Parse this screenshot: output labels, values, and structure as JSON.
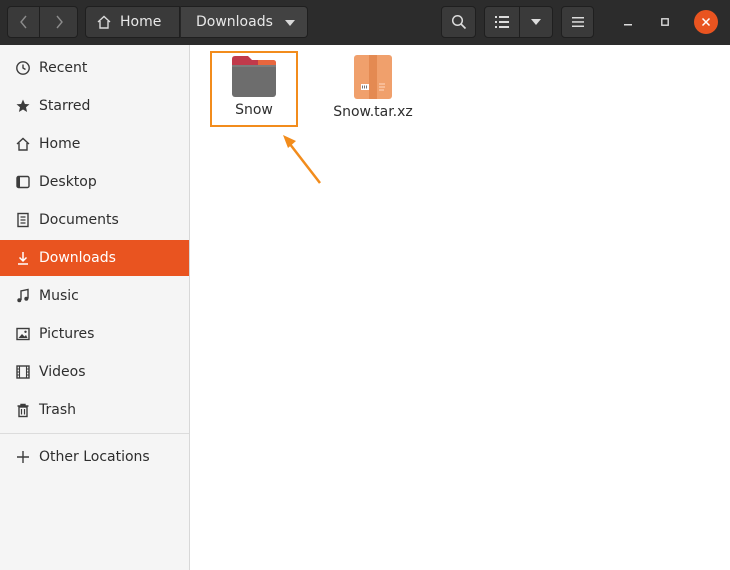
{
  "header": {
    "breadcrumb": {
      "home_label": "Home",
      "current_label": "Downloads"
    }
  },
  "sidebar": {
    "items": [
      {
        "label": "Recent",
        "icon": "clock-icon"
      },
      {
        "label": "Starred",
        "icon": "star-icon"
      },
      {
        "label": "Home",
        "icon": "home-icon"
      },
      {
        "label": "Desktop",
        "icon": "desktop-icon"
      },
      {
        "label": "Documents",
        "icon": "document-icon"
      },
      {
        "label": "Downloads",
        "icon": "download-icon",
        "active": true
      },
      {
        "label": "Music",
        "icon": "music-icon"
      },
      {
        "label": "Pictures",
        "icon": "picture-icon"
      },
      {
        "label": "Videos",
        "icon": "video-icon"
      },
      {
        "label": "Trash",
        "icon": "trash-icon"
      }
    ],
    "other_locations": {
      "label": "Other Locations",
      "icon": "plus-icon"
    }
  },
  "files": [
    {
      "name": "Snow",
      "type": "folder",
      "icon": "folder-icon",
      "highlighted": true
    },
    {
      "name": "Snow.tar.xz",
      "type": "archive",
      "icon": "archive-icon"
    }
  ],
  "colors": {
    "accent": "#e95420",
    "highlight": "#f28c1c",
    "headerbar": "#2c2c2c"
  }
}
